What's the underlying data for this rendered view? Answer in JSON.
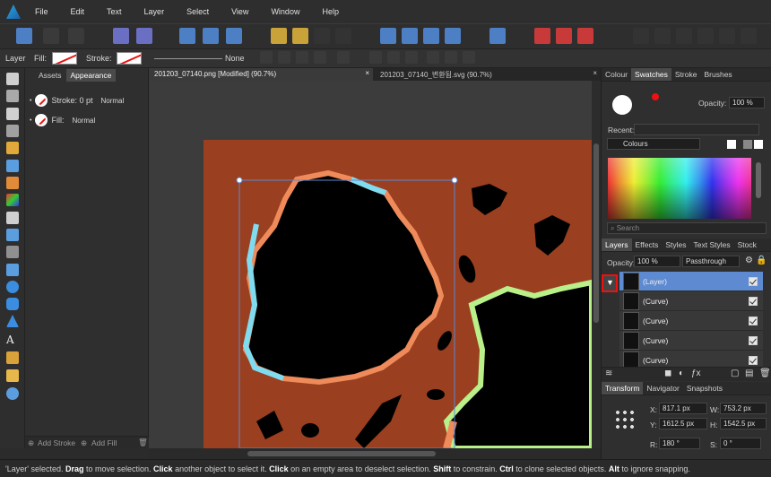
{
  "menu": [
    "File",
    "Edit",
    "Text",
    "Layer",
    "Select",
    "View",
    "Window",
    "Help"
  ],
  "context": {
    "layer_label": "Layer",
    "fill_label": "Fill:",
    "stroke_label": "Stroke:",
    "line_style": "None"
  },
  "left_panel": {
    "tabs": [
      "Assets",
      "Appearance"
    ],
    "stroke": {
      "label": "Stroke: 0 pt",
      "blend": "Normal"
    },
    "fill": {
      "label": "Fill:",
      "blend": "Normal"
    },
    "add_stroke": "Add Stroke",
    "add_fill": "Add Fill"
  },
  "doc_tabs": [
    {
      "title": "201203_07140.png [Modified] (90.7%)",
      "close": "×"
    },
    {
      "title": "201203_07140_변환됨.svg (90.7%)",
      "close": "×"
    }
  ],
  "right_panel": {
    "top_tabs": [
      "Colour",
      "Swatches",
      "Stroke",
      "Brushes"
    ],
    "opacity_label": "Opacity:",
    "opacity_value": "100 %",
    "recent_label": "Recent:",
    "palette_name": "Colours",
    "search_placeholder": "Search",
    "layer_tabs": [
      "Layers",
      "Effects",
      "Styles",
      "Text Styles",
      "Stock"
    ],
    "layers_opacity_label": "Opacity:",
    "layers_opacity_value": "100 %",
    "blend_mode": "Passthrough",
    "layers": [
      {
        "name": "(Layer)",
        "selected": true
      },
      {
        "name": "(Curve)",
        "selected": false
      },
      {
        "name": "(Curve)",
        "selected": false
      },
      {
        "name": "(Curve)",
        "selected": false
      },
      {
        "name": "(Curve)",
        "selected": false
      }
    ],
    "transform_tabs": [
      "Transform",
      "Navigator",
      "Snapshots"
    ],
    "transform": {
      "x_label": "X:",
      "x": "817.1 px",
      "w_label": "W:",
      "w": "753.2 px",
      "y_label": "Y:",
      "y": "1612.5 px",
      "h_label": "H:",
      "h": "1542.5 px",
      "r_label": "R:",
      "r": "180 °",
      "s_label": "S:",
      "s": "0 °"
    }
  },
  "status": {
    "p1": "'Layer' selected. ",
    "k1": "Drag",
    "p2": " to move selection. ",
    "k2": "Click",
    "p3": " another object to select it. ",
    "k3": "Click",
    "p4": " on an empty area to deselect selection. ",
    "k4": "Shift",
    "p5": " to constrain. ",
    "k5": "Ctrl",
    "p6": " to clone selected objects. ",
    "k6": "Alt",
    "p7": " to ignore snapping."
  },
  "colors": {
    "canvas_bg": "#9a3f1f",
    "selection": "#5d8ad0",
    "accent": "#27a9e1"
  }
}
